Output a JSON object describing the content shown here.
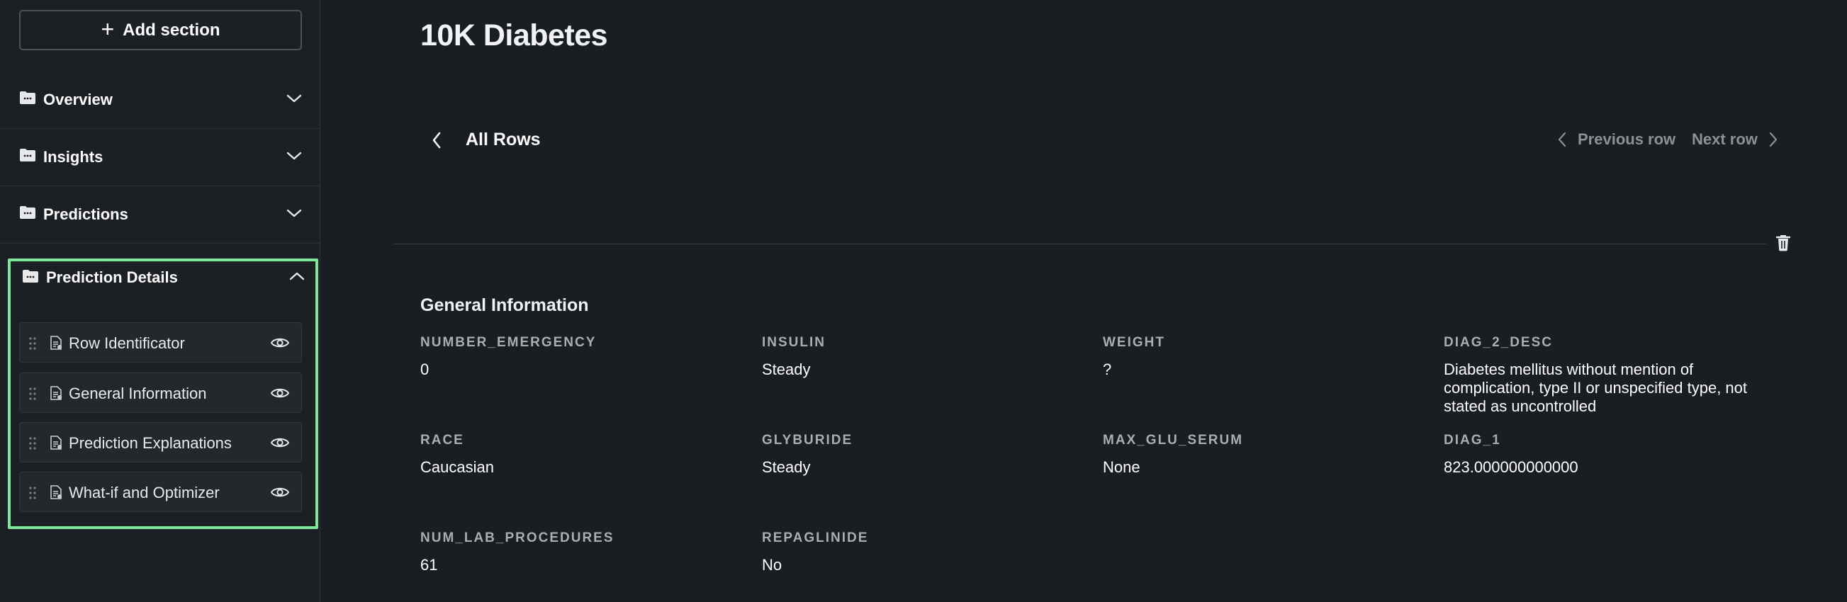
{
  "sidebar": {
    "add_section_label": "Add section",
    "sections": [
      {
        "label": "Overview"
      },
      {
        "label": "Insights"
      },
      {
        "label": "Predictions"
      }
    ],
    "expanded_section": {
      "label": "Prediction Details",
      "items": [
        {
          "label": "Row Identificator"
        },
        {
          "label": "General Information"
        },
        {
          "label": "Prediction Explanations"
        },
        {
          "label": "What-if and Optimizer"
        }
      ]
    },
    "highlight_color": "#7ee99a"
  },
  "main": {
    "title": "10K Diabetes",
    "back_label": "All Rows",
    "previous_row_label": "Previous row",
    "next_row_label": "Next row",
    "section_title": "General Information",
    "fields": [
      {
        "name": "NUMBER_EMERGENCY",
        "value": "0"
      },
      {
        "name": "INSULIN",
        "value": "Steady"
      },
      {
        "name": "WEIGHT",
        "value": "?"
      },
      {
        "name": "DIAG_2_DESC",
        "value": "Diabetes mellitus without mention of complication, type II or unspecified type, not stated as uncontrolled"
      },
      {
        "name": "RACE",
        "value": "Caucasian"
      },
      {
        "name": "GLYBURIDE",
        "value": "Steady"
      },
      {
        "name": "MAX_GLU_SERUM",
        "value": "None"
      },
      {
        "name": "DIAG_1",
        "value": "823.000000000000"
      },
      {
        "name": "NUM_LAB_PROCEDURES",
        "value": "61"
      },
      {
        "name": "REPAGLINIDE",
        "value": "No"
      }
    ]
  }
}
